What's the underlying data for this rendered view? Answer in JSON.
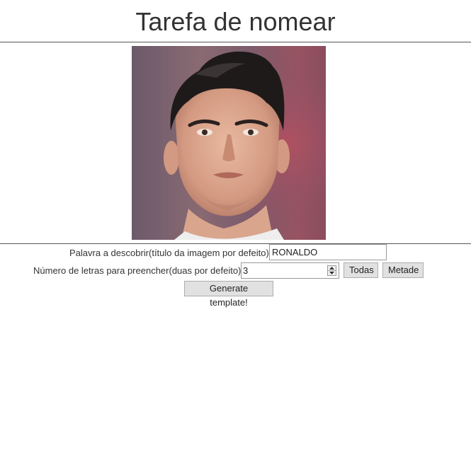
{
  "header": {
    "title": "Tarefa de nomear"
  },
  "image": {
    "subject": "portrait-photo"
  },
  "form": {
    "word_label": "Palavra a descobrir(título da imagem por defeito):",
    "word_value": "RONALDO",
    "letters_label": "Número de letras para preencher(duas por defeito):",
    "letters_value": "3",
    "todas_label": "Todas",
    "metade_label": "Metade",
    "generate_label": "Generate template!"
  },
  "colors": {
    "text": "#333333",
    "button_bg": "#e1e1e1",
    "button_border": "#adadad",
    "divider": "#555555"
  }
}
